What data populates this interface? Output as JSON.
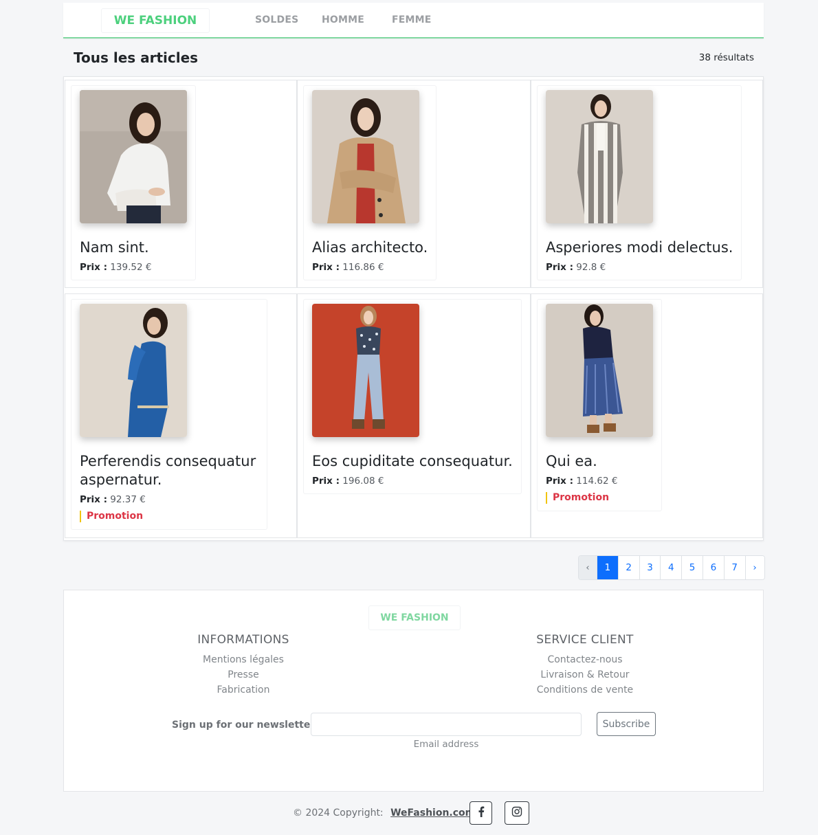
{
  "navbar": {
    "brand": "WE FASHION",
    "links": [
      "SOLDES",
      "HOMME",
      "FEMME"
    ]
  },
  "header": {
    "title": "Tous les articles",
    "results": "38 résultats"
  },
  "colors": {
    "brand": "#4cd07d",
    "promo": "#dc3545",
    "promo_border": "#f1c40f",
    "page_active": "#0d6efd"
  },
  "products": [
    {
      "title": "Nam sint.",
      "price_label": "Prix :",
      "price": "139.52 €",
      "promo": ""
    },
    {
      "title": "Alias architecto.",
      "price_label": "Prix :",
      "price": "116.86 €",
      "promo": ""
    },
    {
      "title": "Asperiores modi delectus.",
      "price_label": "Prix :",
      "price": "92.8 €",
      "promo": ""
    },
    {
      "title_line1": "Perferendis consequatur",
      "title_line2": "aspernatur.",
      "price_label": "Prix :",
      "price": "92.37 €",
      "promo": "Promotion"
    },
    {
      "title": "Eos cupiditate consequatur.",
      "price_label": "Prix :",
      "price": "196.08 €",
      "promo": ""
    },
    {
      "title": "Qui ea.",
      "price_label": "Prix :",
      "price": "114.62 €",
      "promo": "Promotion"
    }
  ],
  "pagination": {
    "prev": "‹",
    "pages": [
      "1",
      "2",
      "3",
      "4",
      "5",
      "6",
      "7"
    ],
    "current": "1",
    "next": "›"
  },
  "footer": {
    "brand": "WE FASHION",
    "informations": {
      "heading": "INFORMATIONS",
      "links": [
        "Mentions légales",
        "Presse",
        "Fabrication"
      ]
    },
    "service": {
      "heading": "SERVICE CLIENT",
      "links": [
        "Contactez-nous",
        "Livraison & Retour",
        "Conditions de vente"
      ]
    },
    "newsletter": {
      "label": "Sign up for our newsletter",
      "input_value": "",
      "help": "Email address",
      "button": "Subscribe"
    }
  },
  "copyright": {
    "text": "© 2024 Copyright:",
    "link": "WeFashion.com"
  },
  "social": [
    "facebook-icon",
    "instagram-icon"
  ]
}
